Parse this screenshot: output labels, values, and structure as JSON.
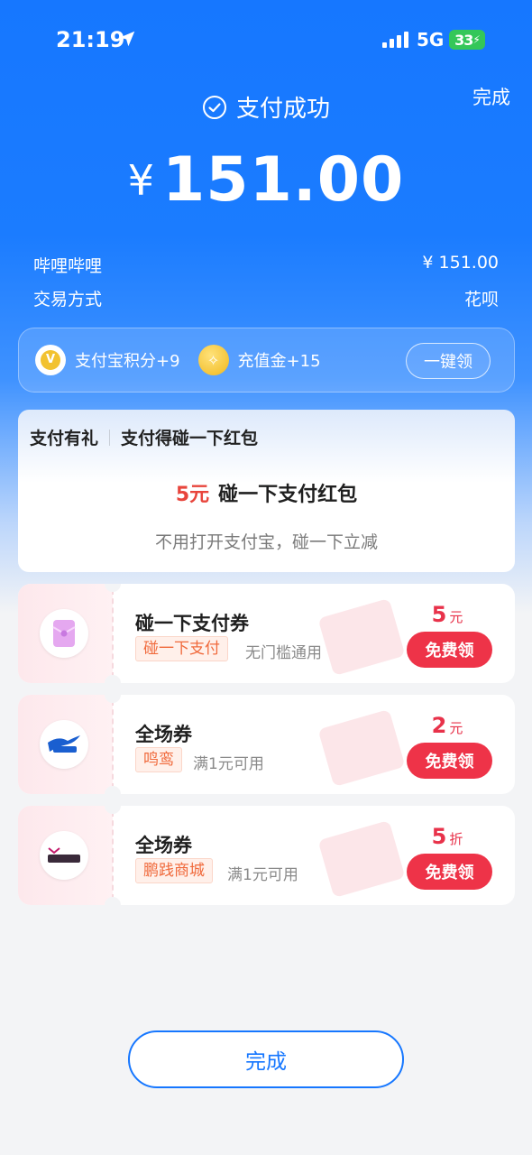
{
  "status_bar": {
    "time": "21:19",
    "network": "5G",
    "battery": "33"
  },
  "header": {
    "done_label": "完成",
    "success_text": "支付成功",
    "currency_symbol": "¥",
    "amount": "151.00"
  },
  "details": {
    "merchant_label": "哔哩哔哩",
    "merchant_amount": "¥ 151.00",
    "method_label": "交易方式",
    "method_value": "花呗"
  },
  "rewards": {
    "points_text": "支付宝积分+9",
    "points_icon": "points-coin-icon",
    "recharge_text": "充值金+15",
    "recharge_icon": "gold-coin-icon",
    "claim_all_label": "一键领"
  },
  "gift": {
    "tag": "支付有礼",
    "heading": "支付得碰一下红包",
    "amount": "5元",
    "title": "碰一下支付红包",
    "subtitle": "不用打开支付宝，碰一下立减"
  },
  "coupons": [
    {
      "title": "碰一下支付券",
      "tag": "碰一下支付",
      "condition": "无门槛通用",
      "value": "5",
      "unit": "元",
      "claim_label": "免费领",
      "logo": "envelope-icon"
    },
    {
      "title": "全场券",
      "tag": "鸣鸾",
      "condition": "满1元可用",
      "value": "2",
      "unit": "元",
      "claim_label": "免费领",
      "logo": "mingluan-logo-icon"
    },
    {
      "title": "全场券",
      "tag": "鹏践商城",
      "condition": "满1元可用",
      "value": "5",
      "unit": "折",
      "claim_label": "免费领",
      "logo": "pengjian-logo-icon"
    }
  ],
  "footer": {
    "done_label": "完成"
  },
  "colors": {
    "primary": "#1677ff",
    "accent_red": "#ee3348",
    "tag_orange": "#f06a3c"
  }
}
